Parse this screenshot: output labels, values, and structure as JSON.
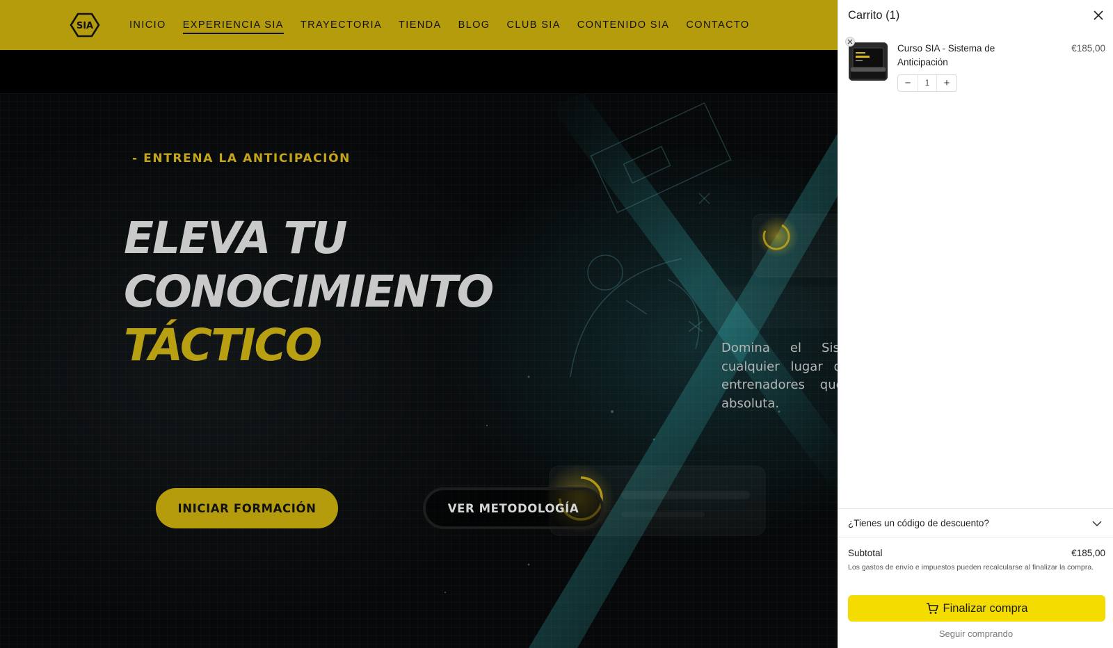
{
  "header": {
    "logo_text": "SIA",
    "nav": [
      {
        "label": "INICIO"
      },
      {
        "label": "EXPERIENCIA SIA",
        "active": true
      },
      {
        "label": "TRAYECTORIA"
      },
      {
        "label": "TIENDA"
      },
      {
        "label": "BLOG"
      },
      {
        "label": "CLUB SIA"
      },
      {
        "label": "CONTENIDO SIA"
      },
      {
        "label": "CONTACTO"
      }
    ]
  },
  "hero": {
    "eyebrow": "- ENTRENA LA ANTICIPACIÓN",
    "headline_line1": "ELEVA TU",
    "headline_line2": "CONOCIMIENTO",
    "headline_line3": "TÁCTICO",
    "description": "Domina el Sistema desde cualquier lugar diseñada para entrenadores que buscan la absoluta.",
    "primary_button": "INICIAR FORMACIÓN",
    "secondary_button": "VER METODOLOGÍA"
  },
  "cart": {
    "title": "Carrito (1)",
    "item": {
      "name": "Curso SIA - Sistema de Anticipación",
      "price": "€185,00",
      "quantity": "1",
      "minus": "−",
      "plus": "+"
    },
    "discount_label": "¿Tienes un código de descuento?",
    "subtotal_label": "Subtotal",
    "subtotal_value": "€185,00",
    "tax_note": "Los gastos de envío e impuestos pueden recalcularse al finalizar la compra.",
    "checkout_label": "Finalizar compra",
    "continue_label": "Seguir comprando"
  },
  "colors": {
    "header_bg": "#b59c0c",
    "accent": "#c4a418",
    "checkout_bg": "#f5dc00"
  }
}
